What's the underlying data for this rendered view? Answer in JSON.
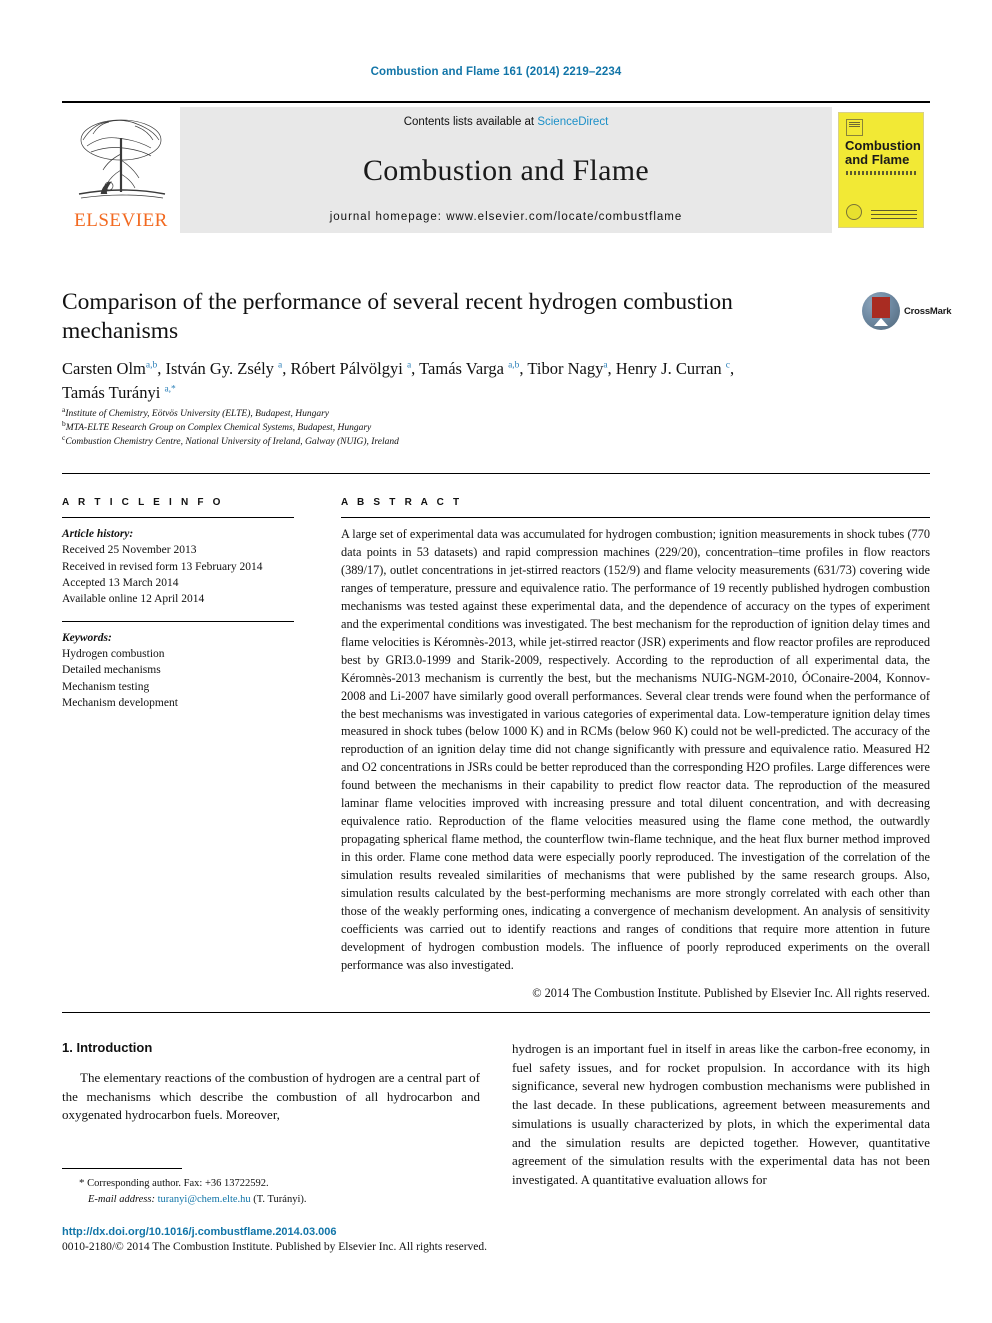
{
  "running_head": "Combustion and Flame 161 (2014) 2219–2234",
  "masthead": {
    "elsevier_wordmark": "ELSEVIER",
    "contents_prefix": "Contents lists available at ",
    "sciencedirect": "ScienceDirect",
    "journal_name": "Combustion and Flame",
    "homepage": "journal homepage: www.elsevier.com/locate/combustflame",
    "cover": {
      "title_line1": "Combustion",
      "title_line2": "and Flame"
    }
  },
  "article": {
    "title": "Comparison of the performance of several recent hydrogen combustion mechanisms",
    "crossmark_label": "CrossMark",
    "authors": "Carsten Olm a,b, István Gy. Zsély a, Róbert Pálvölgyi a, Tamás Varga a,b, Tibor Nagy a, Henry J. Curran c, Tamás Turányi a,*",
    "affiliations": [
      {
        "marker": "a",
        "text": "Institute of Chemistry, Eötvös University (ELTE), Budapest, Hungary"
      },
      {
        "marker": "b",
        "text": "MTA-ELTE Research Group on Complex Chemical Systems, Budapest, Hungary"
      },
      {
        "marker": "c",
        "text": "Combustion Chemistry Centre, National University of Ireland, Galway (NUIG), Ireland"
      }
    ]
  },
  "article_info": {
    "heading": "A R T I C L E   I N F O",
    "history_label": "Article history:",
    "history": [
      "Received 25 November 2013",
      "Received in revised form 13 February 2014",
      "Accepted 13 March 2014",
      "Available online 12 April 2014"
    ],
    "keywords_label": "Keywords:",
    "keywords": [
      "Hydrogen combustion",
      "Detailed mechanisms",
      "Mechanism testing",
      "Mechanism development"
    ]
  },
  "abstract": {
    "heading": "A B S T R A C T",
    "text": "A large set of experimental data was accumulated for hydrogen combustion; ignition measurements in shock tubes (770 data points in 53 datasets) and rapid compression machines (229/20), concentration–time profiles in flow reactors (389/17), outlet concentrations in jet-stirred reactors (152/9) and flame velocity measurements (631/73) covering wide ranges of temperature, pressure and equivalence ratio. The performance of 19 recently published hydrogen combustion mechanisms was tested against these experimental data, and the dependence of accuracy on the types of experiment and the experimental conditions was investigated. The best mechanism for the reproduction of ignition delay times and flame velocities is Kéromnès-2013, while jet-stirred reactor (JSR) experiments and flow reactor profiles are reproduced best by GRI3.0-1999 and Starik-2009, respectively. According to the reproduction of all experimental data, the Kéromnès-2013 mechanism is currently the best, but the mechanisms NUIG-NGM-2010, ÓConaire-2004, Konnov-2008 and Li-2007 have similarly good overall performances. Several clear trends were found when the performance of the best mechanisms was investigated in various categories of experimental data. Low-temperature ignition delay times measured in shock tubes (below 1000 K) and in RCMs (below 960 K) could not be well-predicted. The accuracy of the reproduction of an ignition delay time did not change significantly with pressure and equivalence ratio. Measured H2 and O2 concentrations in JSRs could be better reproduced than the corresponding H2O profiles. Large differences were found between the mechanisms in their capability to predict flow reactor data. The reproduction of the measured laminar flame velocities improved with increasing pressure and total diluent concentration, and with decreasing equivalence ratio. Reproduction of the flame velocities measured using the flame cone method, the outwardly propagating spherical flame method, the counterflow twin-flame technique, and the heat flux burner method improved in this order. Flame cone method data were especially poorly reproduced. The investigation of the correlation of the simulation results revealed similarities of mechanisms that were published by the same research groups. Also, simulation results calculated by the best-performing mechanisms are more strongly correlated with each other than those of the weakly performing ones, indicating a convergence of mechanism development. An analysis of sensitivity coefficients was carried out to identify reactions and ranges of conditions that require more attention in future development of hydrogen combustion models. The influence of poorly reproduced experiments on the overall performance was also investigated.",
    "copyright": "© 2014 The Combustion Institute. Published by Elsevier Inc. All rights reserved."
  },
  "introduction": {
    "heading": "1. Introduction",
    "paragraph_left": "The elementary reactions of the combustion of hydrogen are a central part of the mechanisms which describe the combustion of all hydrocarbon and oxygenated hydrocarbon fuels. Moreover,",
    "paragraph_right": "hydrogen is an important fuel in itself in areas like the carbon-free economy, in fuel safety issues, and for rocket propulsion. In accordance with its high significance, several new hydrogen combustion mechanisms were published in the last decade. In these publications, agreement between measurements and simulations is usually characterized by plots, in which the experimental data and the simulation results are depicted together. However, quantitative agreement of the simulation results with the experimental data has not been investigated. A quantitative evaluation allows for"
  },
  "footer": {
    "corresponding_marker": "*",
    "corresponding_text": "Corresponding author. Fax: +36 13722592.",
    "email_label": "E-mail address:",
    "email": "turanyi@chem.elte.hu",
    "email_owner": "(T. Turányi).",
    "doi": "http://dx.doi.org/10.1016/j.combustflame.2014.03.006",
    "issn_line": "0010-2180/© 2014 The Combustion Institute. Published by Elsevier Inc. All rights reserved."
  },
  "colors": {
    "link": "#1275a8",
    "sciencedirect": "#1c90c8",
    "elsevier_orange": "#f26a21",
    "cover_yellow": "#f2e935",
    "band_gray": "#e8e8e8"
  }
}
